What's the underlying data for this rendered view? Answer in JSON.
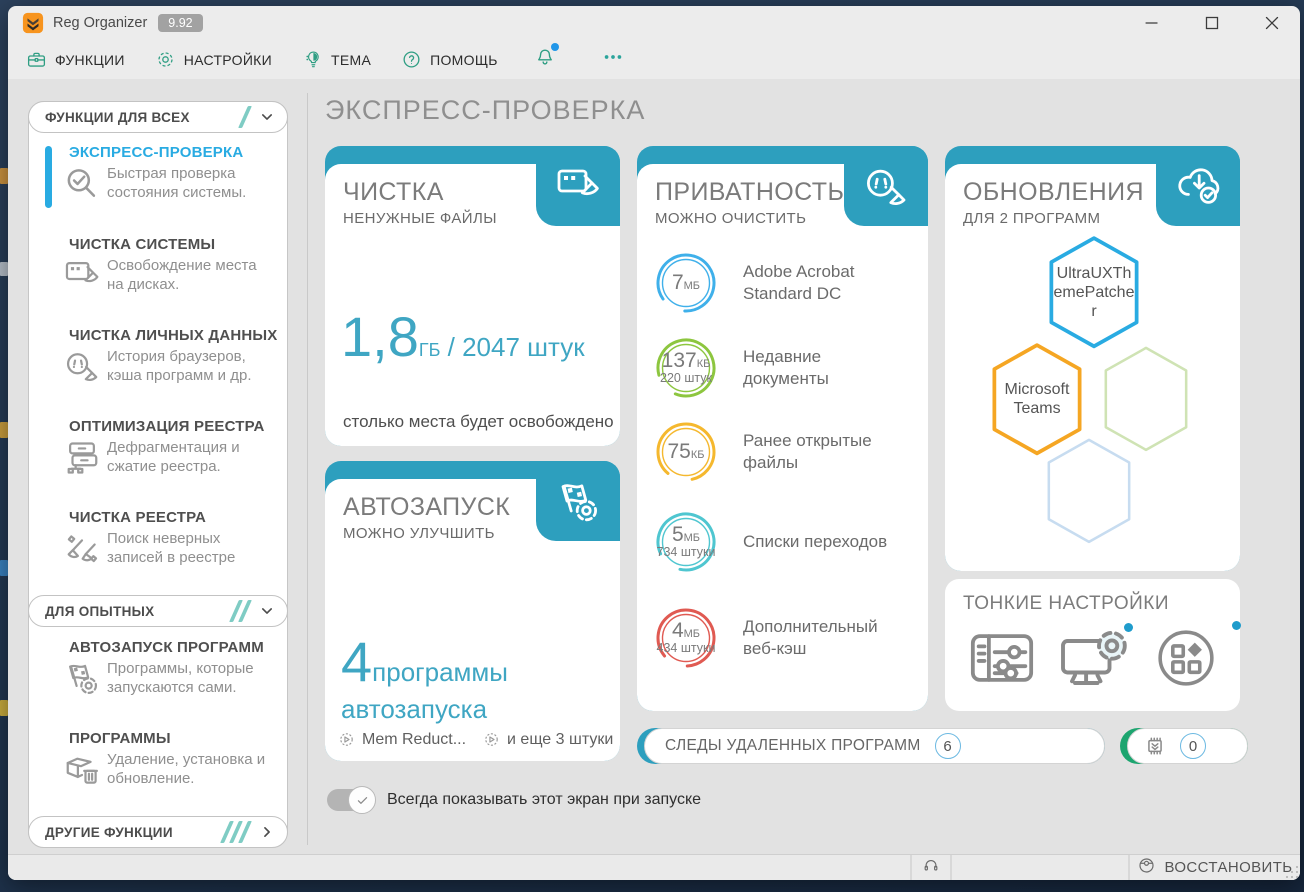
{
  "window": {
    "app_title": "Reg Organizer",
    "version": "9.92"
  },
  "toolbar": {
    "items": [
      {
        "label": "ФУНКЦИИ",
        "icon": "briefcase-icon"
      },
      {
        "label": "НАСТРОЙКИ",
        "icon": "gear-icon"
      },
      {
        "label": "ТЕМА",
        "icon": "bulb-icon"
      },
      {
        "label": "ПОМОЩЬ",
        "icon": "help-icon"
      }
    ],
    "help_glyph": "?"
  },
  "sidebar": {
    "sections": [
      {
        "label": "ФУНКЦИИ ДЛЯ ВСЕХ"
      },
      {
        "label": "ДЛЯ ОПЫТНЫХ"
      },
      {
        "label": "ДРУГИЕ ФУНКЦИИ"
      }
    ],
    "items": [
      {
        "title": "ЭКСПРЕСС-ПРОВЕРКА",
        "description": "Быстрая проверка состояния системы.",
        "icon": "magnifier-check-icon"
      },
      {
        "title": "ЧИСТКА СИСТЕМЫ",
        "description": "Освобождение места на дисках.",
        "icon": "monitor-broom-icon"
      },
      {
        "title": "ЧИСТКА ЛИЧНЫХ ДАННЫХ",
        "description": "История браузеров, кэша программ и др.",
        "icon": "mask-broom-icon"
      },
      {
        "title": "ОПТИМИЗАЦИЯ РЕЕСТРА",
        "description": "Дефрагментация и сжатие реестра.",
        "icon": "drawers-icon"
      },
      {
        "title": "ЧИСТКА РЕЕСТРА",
        "description": "Поиск неверных записей в реестре",
        "icon": "brooms-icon"
      },
      {
        "title": "АВТОЗАПУСК ПРОГРАММ",
        "description": "Программы, которые запускаются сами.",
        "icon": "flag-gear-icon"
      },
      {
        "title": "ПРОГРАММЫ",
        "description": "Удаление, установка и обновление.",
        "icon": "box-trash-icon"
      }
    ]
  },
  "main": {
    "page_title": "ЭКСПРЕСС-ПРОВЕРКА",
    "cleanup_card": {
      "title": "ЧИСТКА",
      "subtitle": "НЕНУЖНЫЕ ФАЙЛЫ",
      "icon": "monitor-broom-icon",
      "value": "1,8",
      "unit": "ГБ",
      "suffix": " / 2047 штук",
      "footnote": "столько места будет освобождено"
    },
    "autostart_card": {
      "title": "АВТОЗАПУСК",
      "subtitle": "МОЖНО УЛУЧШИТЬ",
      "icon": "flag-gear-icon",
      "value": "4",
      "suffix": "программы автозапуска",
      "footer": [
        {
          "label": "Mem Reduct...",
          "icon": "gear-play-icon"
        },
        {
          "label": "и еще 3 штуки",
          "icon": "gear-play-icon"
        }
      ]
    },
    "privacy_card": {
      "title": "ПРИВАТНОСТЬ",
      "subtitle": "МОЖНО ОЧИСТИТЬ",
      "icon": "mask-broom-icon",
      "items": [
        {
          "size": "7",
          "unit": "МБ",
          "count": "",
          "label": "Adobe Acrobat Standard DC",
          "color": "#3fb0ea"
        },
        {
          "size": "137",
          "unit": "КБ",
          "count": "220 штук",
          "label": "Недавние документы",
          "color": "#8dc63f"
        },
        {
          "size": "75",
          "unit": "КБ",
          "count": "",
          "label": "Ранее открытые файлы",
          "color": "#f5b82e"
        },
        {
          "size": "5",
          "unit": "МБ",
          "count": "734 штуки",
          "label": "Списки переходов",
          "color": "#4fc6d0"
        },
        {
          "size": "4",
          "unit": "МБ",
          "count": "434 штуки",
          "label": "Дополнительный веб-кэш",
          "color": "#e05a52"
        }
      ]
    },
    "updates_card": {
      "title": "ОБНОВЛЕНИЯ",
      "subtitle": "ДЛЯ 2 ПРОГРАММ",
      "icon": "cloud-download-icon",
      "programs": [
        {
          "label": "UltraUXThemePatcher",
          "color": "#29abe2"
        },
        {
          "label": "Microsoft Teams",
          "color": "#f5a623"
        }
      ],
      "placeholders": [
        {
          "color": "#cfe3b4"
        },
        {
          "color": "#c7dcf0"
        }
      ]
    },
    "tweaks_card": {
      "title": "ТОНКИЕ НАСТРОЙКИ",
      "icons": [
        "sliders-panel-icon",
        "monitor-gear-icon",
        "apps-icon"
      ]
    },
    "traces_button": {
      "label": "СЛЕДЫ УДАЛЕННЫХ ПРОГРАММ",
      "count": "6"
    },
    "firmware_button": {
      "icon": "chip-icon",
      "count": "0"
    },
    "startup_toggle": {
      "label": "Всегда показывать этот экран при запуске",
      "state": "on"
    }
  },
  "statusbar": {
    "support_icon": "headphones-icon",
    "restore_label": "ВОССТАНОВИТЬ",
    "restore_icon": "restore-icon"
  },
  "colors": {
    "teal_card": "#2d9fbe",
    "accent_blue": "#29abe2",
    "toolbar_icon_green": "#2f9e83",
    "green_notch": "#1ca56f"
  }
}
